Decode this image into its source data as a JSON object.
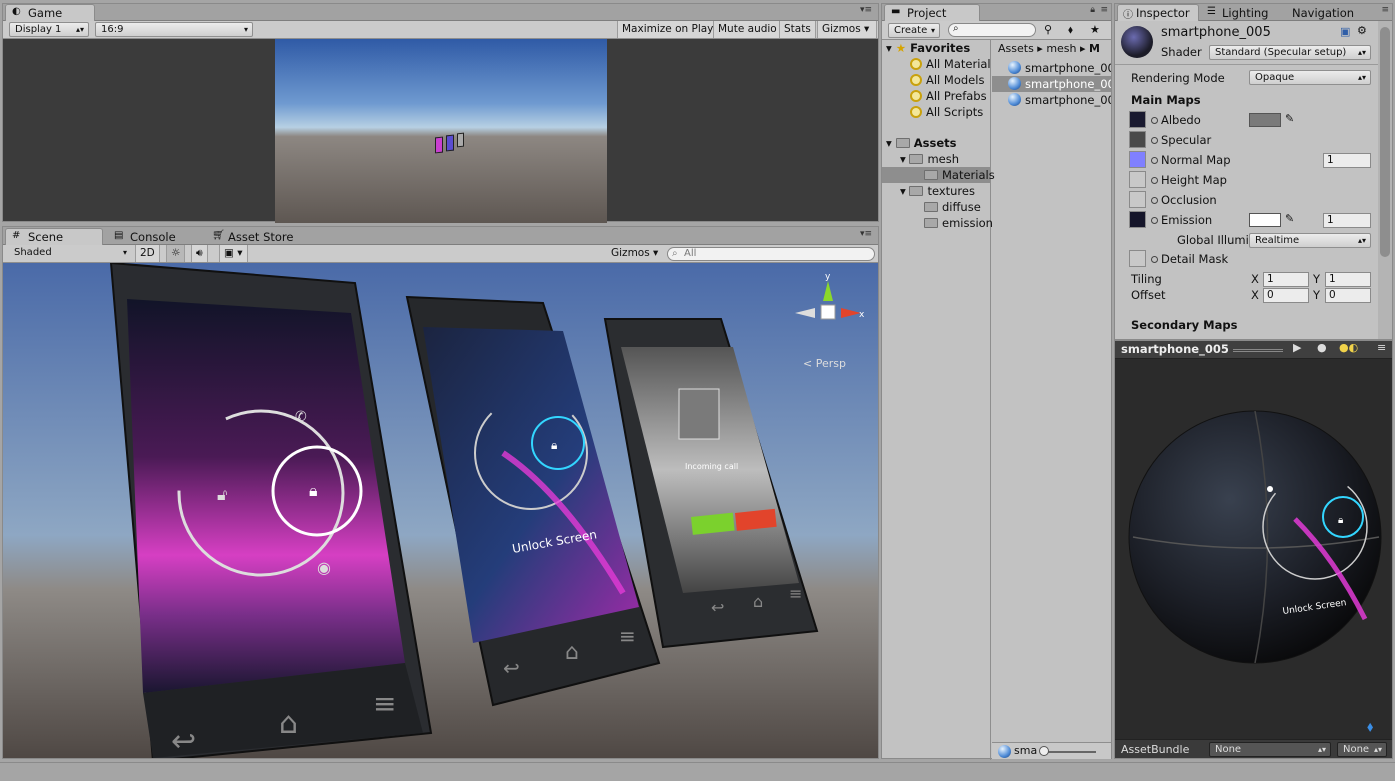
{
  "game": {
    "tab": "Game",
    "display": "Display 1",
    "aspect": "16:9",
    "maximize": "Maximize on Play",
    "mute": "Mute audio",
    "stats": "Stats",
    "gizmos": "Gizmos"
  },
  "scene": {
    "tabs": [
      "Scene",
      "Console",
      "Asset Store"
    ],
    "shading": "Shaded",
    "mode2d": "2D",
    "gizmos": "Gizmos",
    "search_placeholder": "All",
    "persp": "Persp",
    "axis_y": "y",
    "axis_x": "x",
    "phones": {
      "big_unlock": "",
      "mid_unlock": "Unlock Screen",
      "small_incoming": "Incoming call",
      "small_answer": "Answer",
      "small_decline": "Decline"
    }
  },
  "project": {
    "tab": "Project",
    "create": "Create",
    "favorites_label": "Favorites",
    "favorites": [
      "All Material",
      "All Models",
      "All Prefabs",
      "All Scripts"
    ],
    "assets_label": "Assets",
    "tree": {
      "mesh": "mesh",
      "materials": "Materials",
      "textures": "textures",
      "diffuse": "diffuse",
      "emission": "emission"
    },
    "breadcrumb": [
      "Assets",
      "mesh",
      "M"
    ],
    "files": [
      "smartphone_00",
      "smartphone_00",
      "smartphone_00"
    ],
    "bottom_search": "sma"
  },
  "inspector": {
    "tabs": [
      "Inspector",
      "Lighting",
      "Navigation"
    ],
    "material_name": "smartphone_005",
    "shader_label": "Shader",
    "shader": "Standard (Specular setup)",
    "rendering_mode_label": "Rendering Mode",
    "rendering_mode": "Opaque",
    "main_maps": "Main Maps",
    "albedo": "Albedo",
    "specular": "Specular",
    "normal_map": "Normal Map",
    "normal_value": "1",
    "height_map": "Height Map",
    "occlusion": "Occlusion",
    "emission": "Emission",
    "emission_value": "1",
    "global_illum_label": "Global Illumi",
    "global_illum": "Realtime",
    "detail_mask": "Detail Mask",
    "tiling_label": "Tiling",
    "offset_label": "Offset",
    "x_label": "X",
    "y_label": "Y",
    "tiling_x": "1",
    "tiling_y": "1",
    "offset_x": "0",
    "offset_y": "0",
    "secondary_maps": "Secondary Maps",
    "preview_title": "smartphone_005",
    "preview_unlock": "Unlock Screen",
    "assetbundle_label": "AssetBundle",
    "assetbundle": "None",
    "assetbundle_variant": "None"
  },
  "colors": {
    "panel": "#c2c2c2",
    "tabbar": "#a2a2a2",
    "selection": "#8e8e8e",
    "emission_magenta": "#e23bd6",
    "accent_cyan": "#33d6ff"
  }
}
